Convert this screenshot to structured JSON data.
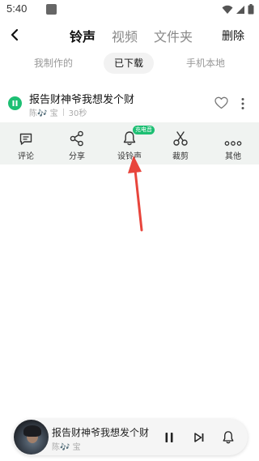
{
  "status_bar": {
    "time": "5:40"
  },
  "header": {
    "tabs": [
      {
        "label": "铃声",
        "active": true
      },
      {
        "label": "视频",
        "active": false
      },
      {
        "label": "文件夹",
        "active": false
      }
    ],
    "delete_label": "删除"
  },
  "segments": [
    {
      "label": "我制作的",
      "selected": false
    },
    {
      "label": "已下载",
      "selected": true
    },
    {
      "label": "手机本地",
      "selected": false
    }
  ],
  "song": {
    "title": "报告财神爷我想发个财",
    "artist": "陈🎶 宝",
    "duration": "30秒"
  },
  "actions": [
    {
      "label": "评论",
      "icon": "comment-icon"
    },
    {
      "label": "分享",
      "icon": "share-icon"
    },
    {
      "label": "设铃声",
      "icon": "bell-icon"
    },
    {
      "label": "裁剪",
      "icon": "scissors-icon"
    },
    {
      "label": "其他",
      "icon": "more-horizontal-icon"
    }
  ],
  "badge": {
    "charge_label": "充电音",
    "color": "#1dbf73"
  },
  "annotation": {
    "arrow_color": "#e8453c"
  },
  "player": {
    "title": "报告财神爷我想发个财",
    "artist": "陈🎶 宝"
  },
  "colors": {
    "accent": "#1dbf73",
    "action_bar_bg": "#f0f3f1"
  }
}
